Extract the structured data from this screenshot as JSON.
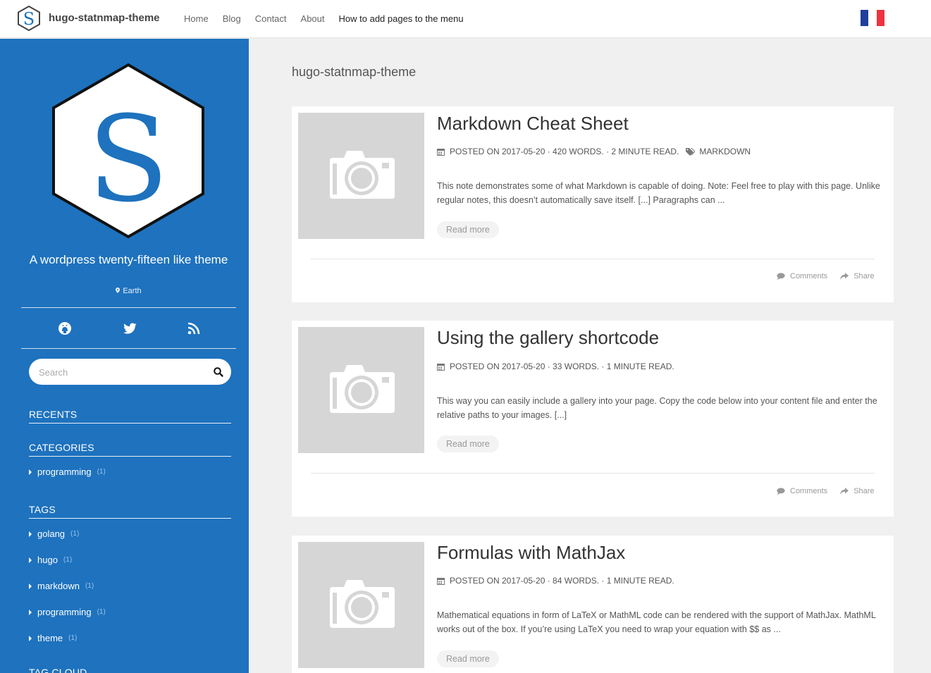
{
  "header": {
    "site_title": "hugo-statnmap-theme",
    "nav": [
      "Home",
      "Blog",
      "Contact",
      "About",
      "How to add pages to the menu"
    ],
    "brand_color": "#1e72be"
  },
  "sidebar": {
    "logo_letter": "S",
    "tagline": "A wordpress twenty-fifteen like theme",
    "location": "Earth",
    "social_icons": [
      "github-icon",
      "twitter-icon",
      "rss-icon"
    ],
    "search_placeholder": "Search",
    "recents_title": "RECENTS",
    "categories_title": "CATEGORIES",
    "categories": [
      {
        "label": "programming",
        "count": "(1)"
      }
    ],
    "tags_title": "TAGS",
    "tags": [
      {
        "label": "golang",
        "count": "(1)"
      },
      {
        "label": "hugo",
        "count": "(1)"
      },
      {
        "label": "markdown",
        "count": "(1)"
      },
      {
        "label": "programming",
        "count": "(1)"
      },
      {
        "label": "theme",
        "count": "(1)"
      }
    ],
    "tag_cloud_title": "TAG CLOUD"
  },
  "main": {
    "heading": "hugo-statnmap-theme",
    "read_more": "Read more",
    "comments": "Comments",
    "share": "Share",
    "posts": [
      {
        "title": "Markdown Cheat Sheet",
        "meta": "POSTED ON 2017-05-20 · 420 WORDS. · 2 MINUTE READ.",
        "tag": "MARKDOWN",
        "summary": "This note demonstrates some of what Markdown is capable of doing. Note: Feel free to play with this page. Unlike regular notes, this doesn’t automatically save itself. [...] Paragraphs can ..."
      },
      {
        "title": "Using the gallery shortcode",
        "meta": "POSTED ON 2017-05-20 · 33 WORDS. · 1 MINUTE READ.",
        "tag": "",
        "summary": "This way you can easily include a gallery into your page. Copy the code below into your content file and enter the relative paths to your images. [...]"
      },
      {
        "title": "Formulas with MathJax",
        "meta": "POSTED ON 2017-05-20 · 84 WORDS. · 1 MINUTE READ.",
        "tag": "",
        "summary": "Mathematical equations in form of LaTeX or MathML code can be rendered with the support of MathJax. MathML works out of the box. If you’re using LaTeX you need to wrap your equation with $$ as ..."
      }
    ]
  }
}
